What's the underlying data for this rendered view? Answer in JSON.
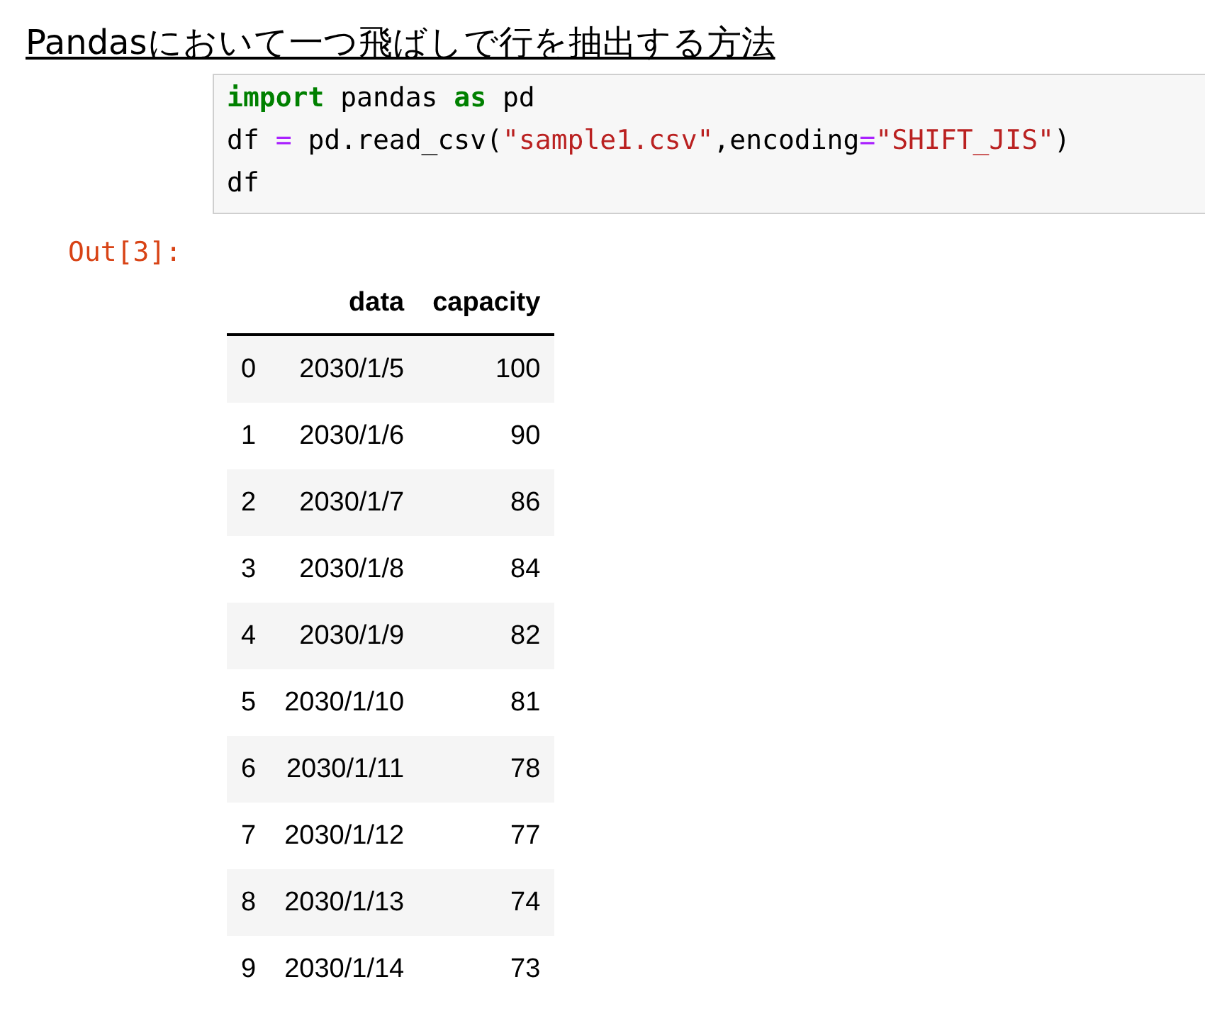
{
  "title": "Pandasにおいて一つ飛ばしで行を抽出する方法",
  "code_cell": {
    "lines": [
      [
        {
          "kind": "keyword",
          "text": "import"
        },
        {
          "kind": "plain",
          "text": " pandas "
        },
        {
          "kind": "keyword",
          "text": "as"
        },
        {
          "kind": "plain",
          "text": " pd"
        }
      ],
      [
        {
          "kind": "plain",
          "text": "df "
        },
        {
          "kind": "operator",
          "text": "="
        },
        {
          "kind": "plain",
          "text": " pd.read_csv("
        },
        {
          "kind": "string",
          "text": "\"sample1.csv\""
        },
        {
          "kind": "plain",
          "text": ",encoding"
        },
        {
          "kind": "operator",
          "text": "="
        },
        {
          "kind": "string",
          "text": "\"SHIFT_JIS\""
        },
        {
          "kind": "plain",
          "text": ")"
        }
      ],
      [
        {
          "kind": "plain",
          "text": "df"
        }
      ]
    ]
  },
  "output_prompt": "Out[3]:",
  "table": {
    "columns": [
      "",
      "data",
      "capacity"
    ],
    "rows": [
      [
        "0",
        "2030/1/5",
        "100"
      ],
      [
        "1",
        "2030/1/6",
        "90"
      ],
      [
        "2",
        "2030/1/7",
        "86"
      ],
      [
        "3",
        "2030/1/8",
        "84"
      ],
      [
        "4",
        "2030/1/9",
        "82"
      ],
      [
        "5",
        "2030/1/10",
        "81"
      ],
      [
        "6",
        "2030/1/11",
        "78"
      ],
      [
        "7",
        "2030/1/12",
        "77"
      ],
      [
        "8",
        "2030/1/13",
        "74"
      ],
      [
        "9",
        "2030/1/14",
        "73"
      ]
    ]
  }
}
